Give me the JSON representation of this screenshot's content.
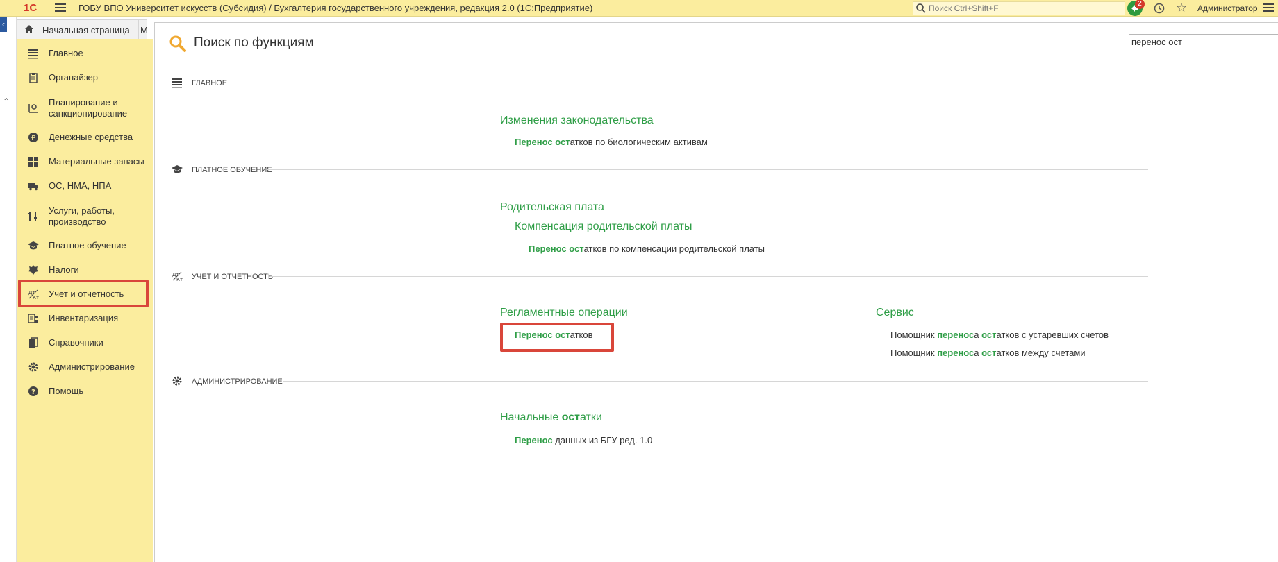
{
  "topbar": {
    "logo": "1С",
    "title": "ГОБУ ВПО Университет искусств (Субсидия) / Бухгалтерия государственного учреждения, редакция 2.0  (1С:Предприятие)",
    "search_placeholder": "Поиск Ctrl+Shift+F",
    "notifications_count": "2",
    "user": "Администратор"
  },
  "tabs": {
    "home": "Начальная страница",
    "second": "М"
  },
  "sidebar": {
    "items": [
      {
        "label": "Главное",
        "icon": "list-icon"
      },
      {
        "label": "Органайзер",
        "icon": "clipboard-icon"
      },
      {
        "label": "Планирование и санкционирование",
        "icon": "planning-icon"
      },
      {
        "label": "Денежные средства",
        "icon": "ruble-icon"
      },
      {
        "label": "Материальные запасы",
        "icon": "grid-icon"
      },
      {
        "label": "ОС, НМА, НПА",
        "icon": "truck-icon"
      },
      {
        "label": "Услуги, работы, производство",
        "icon": "tools-icon"
      },
      {
        "label": "Платное обучение",
        "icon": "graduation-cap-icon"
      },
      {
        "label": "Налоги",
        "icon": "emblem-icon"
      },
      {
        "label": "Учет и отчетность",
        "icon": "debit-credit-icon"
      },
      {
        "label": "Инвентаризация",
        "icon": "inventory-icon"
      },
      {
        "label": "Справочники",
        "icon": "books-icon"
      },
      {
        "label": "Администрирование",
        "icon": "gear-icon"
      },
      {
        "label": "Помощь",
        "icon": "help-icon"
      }
    ],
    "active_index": 9
  },
  "main": {
    "title": "Поиск по функциям",
    "search_value": "перенос ост",
    "sections": [
      {
        "label": "ГЛАВНОЕ",
        "groups": [
          {
            "title": "Изменения законодательства",
            "links": [
              {
                "bold1": "Перенос",
                "mid1": " ",
                "bold2": "ост",
                "rest": "атков по биологическим активам"
              }
            ]
          }
        ]
      },
      {
        "label": "ПЛАТНОЕ ОБУЧЕНИЕ",
        "groups": [
          {
            "title": "Родительская плата",
            "subtitle": "Компенсация родительской платы",
            "links": [
              {
                "bold1": "Перенос",
                "mid1": " ",
                "bold2": "ост",
                "rest": "атков по компенсации родительской платы"
              }
            ]
          }
        ]
      },
      {
        "label": "УЧЕТ И ОТЧЕТНОСТЬ",
        "groups": [
          {
            "title": "Регламентные операции",
            "links": [
              {
                "bold1": "Перенос",
                "mid1": " ",
                "bold2": "ост",
                "rest": "атков"
              }
            ]
          },
          {
            "title": "Сервис",
            "links": [
              {
                "pre": "Помощник ",
                "bold1": "перенос",
                "mid1": "а ",
                "bold2": "ост",
                "rest": "атков с устаревших счетов"
              },
              {
                "pre": "Помощник ",
                "bold1": "перенос",
                "mid1": "а ",
                "bold2": "ост",
                "rest": "атков между счетами"
              }
            ]
          }
        ]
      },
      {
        "label": "АДМИНИСТРИРОВАНИЕ",
        "groups": [
          {
            "title_pre": "Начальные ",
            "title_bold": "ост",
            "title_rest": "атки",
            "links": [
              {
                "bold1": "Перенос",
                "rest": " данных из БГУ ред. 1.0"
              }
            ]
          }
        ]
      }
    ]
  },
  "colors": {
    "accent_green": "#2f9e47",
    "sidebar_bg": "#fbed9e",
    "highlight_red": "#d9463a"
  }
}
